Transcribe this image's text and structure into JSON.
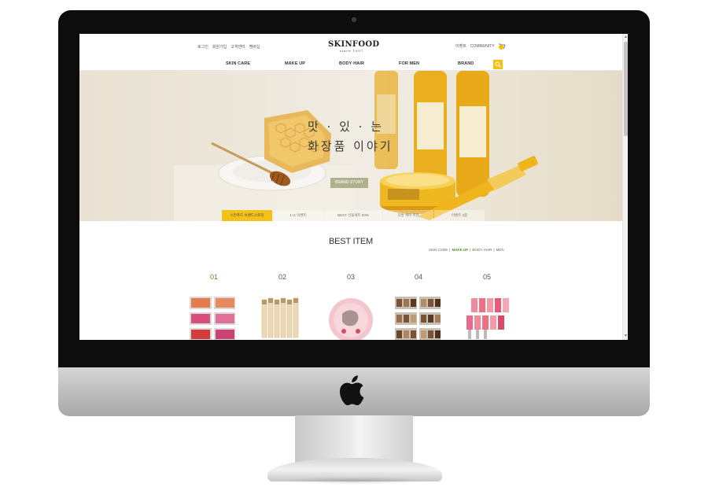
{
  "site": {
    "top_links": [
      "로그인",
      "회원가입",
      "고객센터",
      "멤버십"
    ],
    "logo": "SKINFOOD",
    "logo_sub": "since 1957",
    "right_links": [
      "이벤트",
      "COMMUNITY"
    ],
    "nav": [
      "SKIN CARE",
      "MAKE UP",
      "BODY·HAIR",
      "FOR MEN",
      "BRAND"
    ],
    "hero": {
      "line1": "맛 · 있 · 는",
      "line2": "화장품 이야기",
      "button": "BRAND STORY",
      "tabs": [
        "스킨푸드 브랜드스토리",
        "1+1 이벤트",
        "BEST 선물세트 50%",
        "모발 케어 추천",
        "이벤트 3종"
      ]
    },
    "best": {
      "title": "BEST ITEM",
      "filters": [
        "SKIN CARE",
        "MAKE UP",
        "BODY·HAIR",
        "MEN"
      ],
      "active_filter": "MAKE UP",
      "ranks": [
        "01",
        "02",
        "03",
        "04",
        "05"
      ]
    }
  },
  "colors": {
    "accent_yellow": "#f4c20d",
    "accent_green": "#5b8a1e",
    "frame": "#0d0d0d"
  }
}
